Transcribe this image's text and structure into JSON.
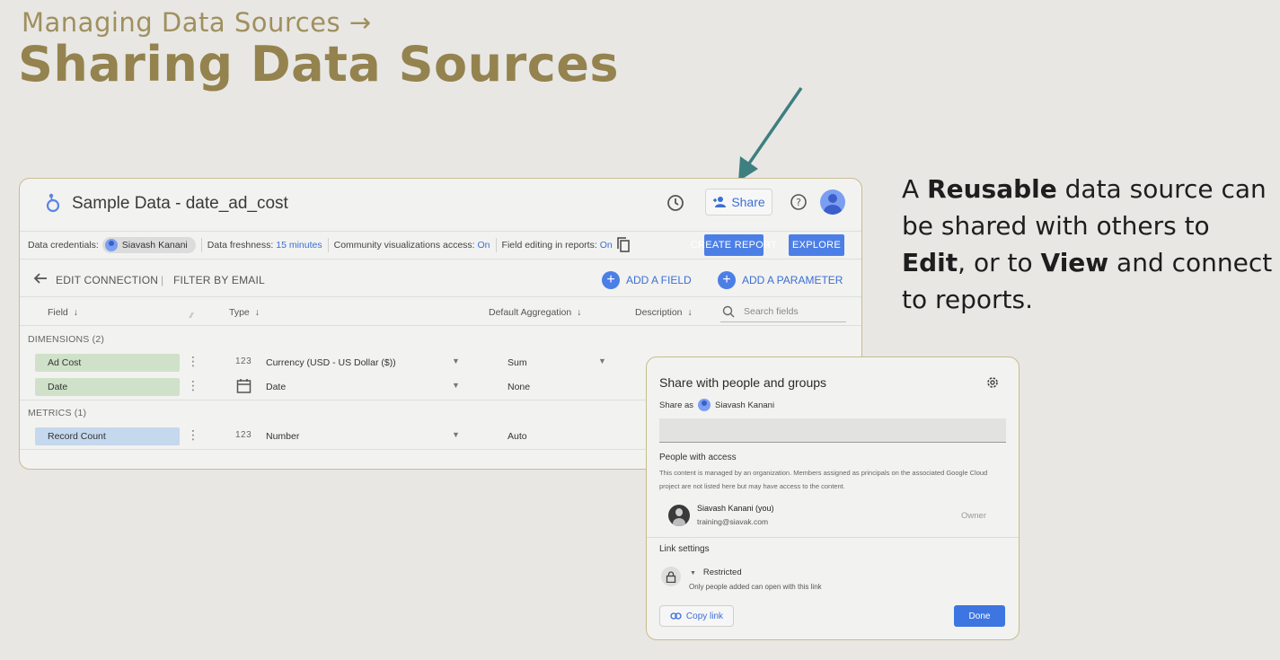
{
  "slide": {
    "subtitle": "Managing Data Sources →",
    "title": "Sharing Data Sources",
    "description_parts": [
      "A ",
      "Reusable",
      " data source can be shared with others to ",
      "Edit",
      ", or to ",
      "View",
      " and connect to reports."
    ]
  },
  "app": {
    "title": "Sample Data - date_ad_cost",
    "share_label": "Share",
    "credentials": {
      "label": "Data credentials:",
      "user": "Siavash Kanani",
      "freshness_label": "Data freshness:",
      "freshness_value": "15 minutes",
      "community_label": "Community visualizations access:",
      "community_value": "On",
      "field_editing_label": "Field editing in reports:",
      "field_editing_value": "On"
    },
    "create_report_label": "CREATE REPORT",
    "explore_label": "EXPLORE",
    "edit_connection_label": "EDIT CONNECTION",
    "divider": "|",
    "filter_label": "FILTER BY EMAIL",
    "add_field_label": "ADD A FIELD",
    "add_parameter_label": "ADD A PARAMETER",
    "columns": {
      "field": "Field",
      "type": "Type",
      "aggregation": "Default Aggregation",
      "description": "Description",
      "search_placeholder": "Search fields"
    },
    "dimensions_label": "DIMENSIONS (2)",
    "metrics_label": "METRICS (1)",
    "dimensions": [
      {
        "name": "Ad Cost",
        "type_icon": "123",
        "type": "Currency (USD - US Dollar ($))",
        "aggregation": "Sum"
      },
      {
        "name": "Date",
        "type_icon": "calendar-icon",
        "type": "Date",
        "aggregation": "None"
      }
    ],
    "metrics": [
      {
        "name": "Record Count",
        "type_icon": "123",
        "type": "Number",
        "aggregation": "Auto"
      }
    ]
  },
  "dialog": {
    "title": "Share with people and groups",
    "share_as_label": "Share as",
    "share_as_user": "Siavash Kanani",
    "people_label": "People with access",
    "note": "This content is managed by an organization. Members assigned as principals on the associated Google Cloud project are not listed here but may have access to the content.",
    "person_name": "Siavash Kanani (you)",
    "person_email": "training@siavak.com",
    "person_role": "Owner",
    "link_settings_label": "Link settings",
    "restricted_label": "Restricted",
    "restricted_desc": "Only people added can open with this link",
    "copy_link_label": "Copy link",
    "done_label": "Done"
  },
  "colors": {
    "title_gold": "#94834e",
    "accent_blue": "#4c7fe6",
    "arrow_teal": "#3e7f7f",
    "dimension_green": "#cfe2c9",
    "metric_blue": "#c4d8ee"
  }
}
